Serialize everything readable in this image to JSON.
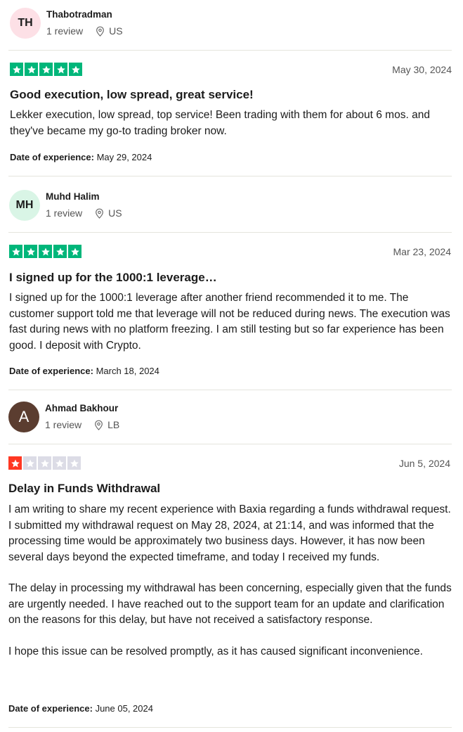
{
  "reviews": [
    {
      "initials": "TH",
      "name": "Thabotradman",
      "review_count": "1 review",
      "country": "US",
      "rating": 5,
      "date": "May 30, 2024",
      "title": "Good execution, low spread, great service!",
      "body": [
        "Lekker execution, low spread, top service! Been trading with them for about 6 mos. and they've became my go-to trading broker now."
      ],
      "experience_label": "Date of experience:",
      "experience_date": "May 29, 2024"
    },
    {
      "initials": "MH",
      "name": "Muhd Halim",
      "review_count": "1 review",
      "country": "US",
      "rating": 5,
      "date": "Mar 23, 2024",
      "title": "I signed up for the 1000:1 leverage…",
      "body": [
        "I signed up for the 1000:1 leverage after another friend recommended it to me. The customer support told me that leverage will not be reduced during news. The execution was fast during news with no platform freezing. I am still testing but so far experience has been good. I deposit with Crypto."
      ],
      "experience_label": "Date of experience:",
      "experience_date": "March 18, 2024"
    },
    {
      "initials": "A",
      "name": "Ahmad Bakhour",
      "review_count": "1 review",
      "country": "LB",
      "rating": 1,
      "date": "Jun 5, 2024",
      "title": "Delay in Funds Withdrawal",
      "body": [
        "I am writing to share my recent experience with Baxia regarding a funds withdrawal request. I submitted my withdrawal request on May 28, 2024, at 21:14, and was informed that the processing time would be approximately two business days. However, it has now been several days beyond the expected timeframe, and today I received my funds.",
        "The delay in processing my withdrawal has been concerning, especially given that the funds are urgently needed. I have reached out to the support team for an update and clarification on the reasons for this delay, but have not received a satisfactory response.",
        "I hope this issue can be resolved promptly, as it has caused significant inconvenience."
      ],
      "experience_label": "Date of experience:",
      "experience_date": "June 05, 2024"
    }
  ],
  "colors": {
    "star_green": "#00b67a",
    "star_red": "#ff3722",
    "star_empty": "#dcdce6",
    "avatar_th": "#fde0e6",
    "avatar_mh": "#d9f5e6",
    "avatar_a": "#5b3d30"
  },
  "icons": {
    "location": "map-pin-icon",
    "star": "star-icon"
  }
}
